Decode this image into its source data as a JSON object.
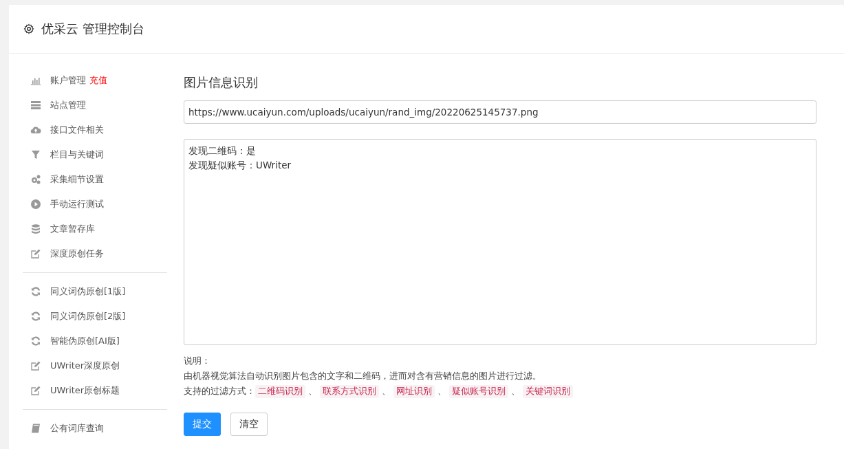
{
  "header": {
    "title": "优采云 管理控制台"
  },
  "sidebar": {
    "groups": [
      {
        "items": [
          {
            "label": "账户管理",
            "kind": "chart",
            "badge": "充值"
          },
          {
            "label": "站点管理",
            "kind": "server"
          },
          {
            "label": "接口文件相关",
            "kind": "cloud"
          },
          {
            "label": "栏目与关键词",
            "kind": "filter"
          },
          {
            "label": "采集细节设置",
            "kind": "gears"
          },
          {
            "label": "手动运行测试",
            "kind": "play"
          },
          {
            "label": "文章暂存库",
            "kind": "database"
          },
          {
            "label": "深度原创任务",
            "kind": "edit"
          }
        ]
      },
      {
        "items": [
          {
            "label": "同义词伪原创[1版]",
            "kind": "refresh"
          },
          {
            "label": "同义词伪原创[2版]",
            "kind": "refresh"
          },
          {
            "label": "智能伪原创[AI版]",
            "kind": "refresh"
          },
          {
            "label": "UWriter深度原创",
            "kind": "edit"
          },
          {
            "label": "UWriter原创标题",
            "kind": "edit"
          }
        ]
      },
      {
        "items": [
          {
            "label": "公有词库查询",
            "kind": "book"
          }
        ]
      }
    ]
  },
  "main": {
    "heading": "图片信息识别",
    "url_field": {
      "value": "https://www.ucaiyun.com/uploads/ucaiyun/rand_img/20220625145737.png"
    },
    "result_box": {
      "lines": [
        "发现二维码：是",
        "发现疑似账号：UWriter"
      ]
    },
    "note_title": "说明：",
    "note_text": "由机器视觉算法自动识别图片包含的文字和二维码，进而对含有营销信息的图片进行过滤。",
    "methods_label": "支持的过滤方式：",
    "methods": [
      "二维码识别",
      "联系方式识别",
      "网址识别",
      "疑似账号识别",
      "关键词识别"
    ],
    "separator": "、",
    "buttons": [
      {
        "label": "提交",
        "kind": "primary"
      },
      {
        "label": "清空",
        "kind": "default"
      }
    ]
  }
}
